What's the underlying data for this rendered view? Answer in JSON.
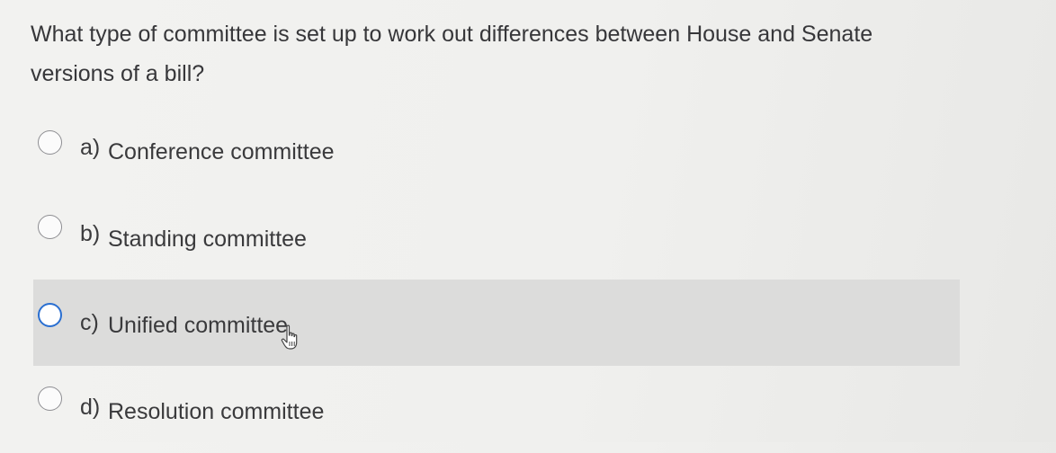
{
  "question": {
    "text": "What type of committee is set up to work out differences between House and Senate versions of a bill?"
  },
  "options": [
    {
      "letter": "a)",
      "text": "Conference committee",
      "selected": false
    },
    {
      "letter": "b)",
      "text": "Standing committee",
      "selected": false
    },
    {
      "letter": "c)",
      "text": "Unified committee",
      "selected": false,
      "hovered": true
    },
    {
      "letter": "d)",
      "text": "Resolution committee",
      "selected": false
    }
  ],
  "colors": {
    "hover_row": "#dcdcdb",
    "focus_ring": "#2a6fd1",
    "text": "#3a3a3c"
  },
  "cursor": {
    "icon": "hand-pointer-icon"
  }
}
